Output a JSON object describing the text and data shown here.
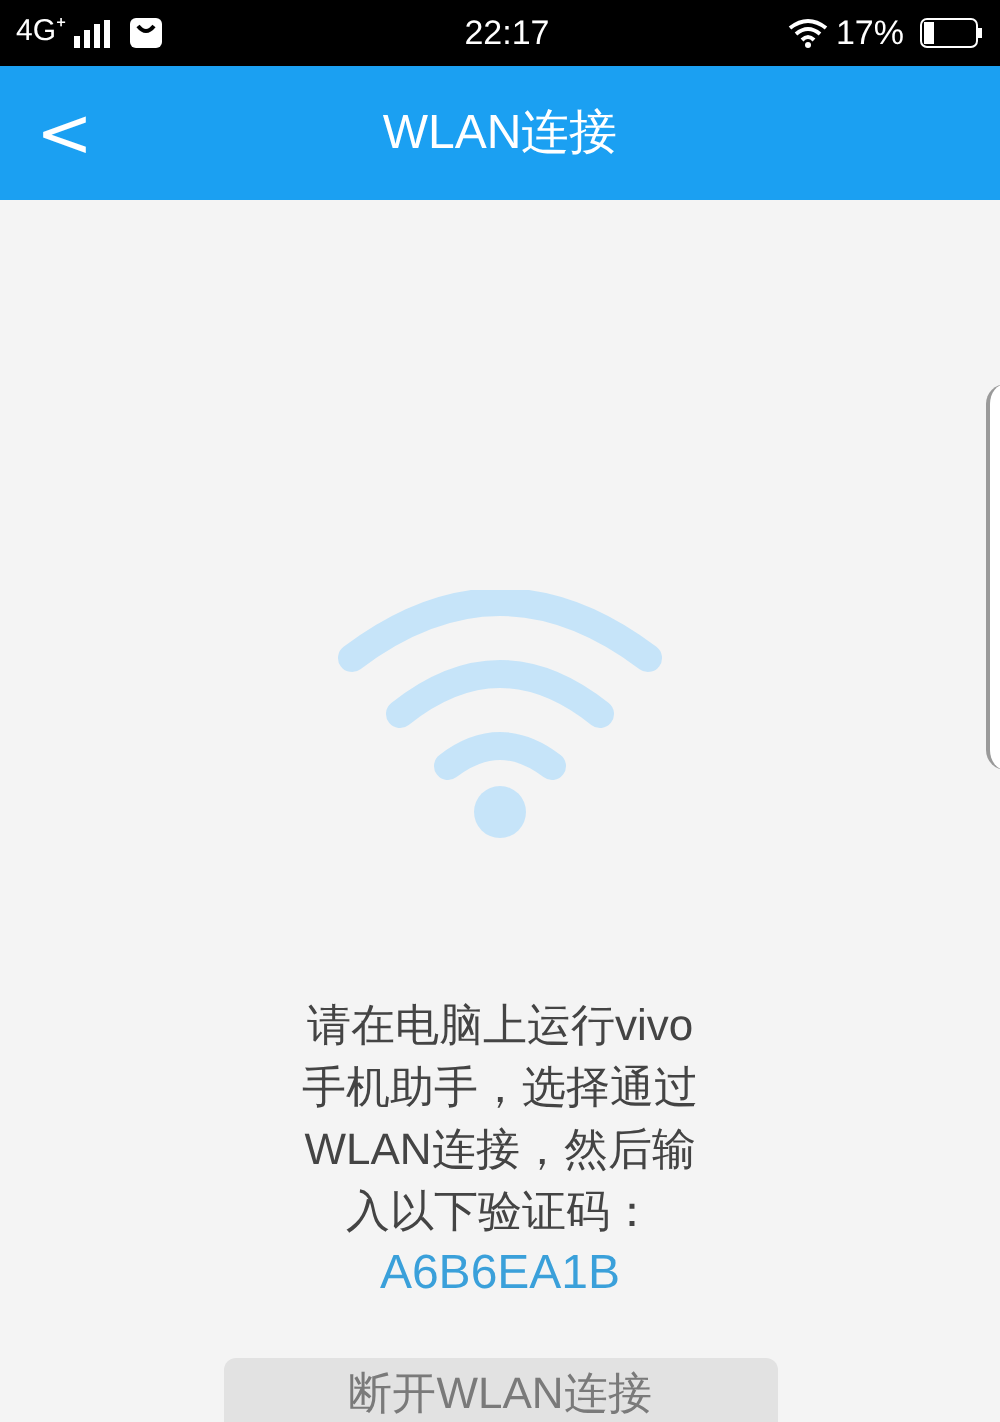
{
  "status_bar": {
    "network": "4G⁺",
    "time": "22:17",
    "battery": "17%"
  },
  "header": {
    "back": "<",
    "title": "WLAN连接"
  },
  "instructions": "请在电脑上运行vivo手机助手，选择通过WLAN连接，然后输入以下验证码：",
  "code": "A6B6EA1B",
  "button": "断开WLAN连接"
}
